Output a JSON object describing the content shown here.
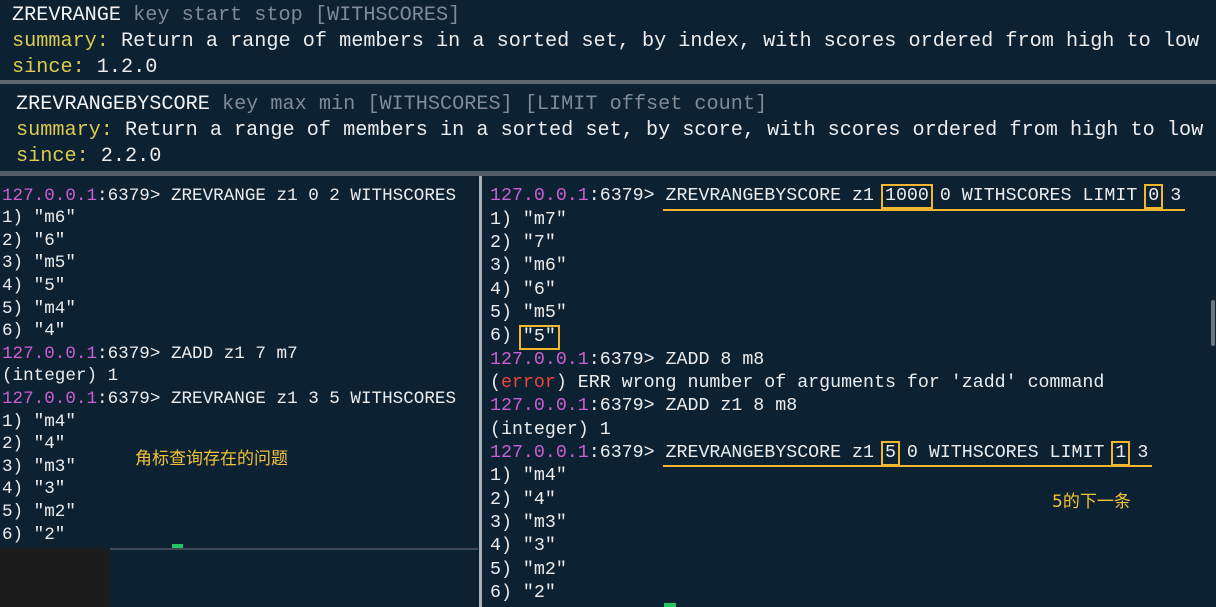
{
  "colors": {
    "background": "#0c2132",
    "text": "#ececec",
    "muted": "#7f8b97",
    "label": "#dccb50",
    "host": "#cc5fd1",
    "error": "#e8473c",
    "highlight": "#f0b72f",
    "annotation": "#f2c23a",
    "cursor": "#22c55e"
  },
  "help": [
    {
      "command": "ZREVRANGE",
      "args": "key start stop [WITHSCORES]",
      "summary_label": "summary:",
      "summary": "Return a range of members in a sorted set, by index, with scores ordered from high to low",
      "since_label": "since:",
      "since": "1.2.0"
    },
    {
      "command": "ZREVRANGEBYSCORE",
      "args": "key max min [WITHSCORES] [LIMIT offset count]",
      "summary_label": "summary:",
      "summary": "Return a range of members in a sorted set, by score, with scores ordered from high to low",
      "since_label": "since:",
      "since": "2.2.0"
    }
  ],
  "prompt": {
    "host": "127.0.0.1",
    "port": ":6379>"
  },
  "left_terminal": {
    "entries": [
      {
        "command": "ZREVRANGE z1 0 2 WITHSCORES",
        "results": [
          {
            "index": "1)",
            "value": "\"m6\""
          },
          {
            "index": "2)",
            "value": "\"6\""
          },
          {
            "index": "3)",
            "value": "\"m5\""
          },
          {
            "index": "4)",
            "value": "\"5\""
          },
          {
            "index": "5)",
            "value": "\"m4\""
          },
          {
            "index": "6)",
            "value": "\"4\""
          }
        ]
      },
      {
        "command": "ZADD z1 7 m7",
        "reply": "(integer) 1"
      },
      {
        "command": "ZREVRANGE z1 3 5 WITHSCORES",
        "results": [
          {
            "index": "1)",
            "value": "\"m4\""
          },
          {
            "index": "2)",
            "value": "\"4\""
          },
          {
            "index": "3)",
            "value": "\"m3\""
          },
          {
            "index": "4)",
            "value": "\"3\""
          },
          {
            "index": "5)",
            "value": "\"m2\""
          },
          {
            "index": "6)",
            "value": "\"2\""
          }
        ]
      }
    ],
    "annotation": "角标查询存在的问题"
  },
  "right_terminal": {
    "entries": [
      {
        "underlined": true,
        "command_segments": [
          {
            "text": "ZREVRANGEBYSCORE z1 "
          },
          {
            "text": "1000",
            "boxed": true
          },
          {
            "text": " 0 WITHSCORES LIMIT "
          },
          {
            "text": "0",
            "boxed": true
          },
          {
            "text": " 3"
          }
        ],
        "results": [
          {
            "index": "1)",
            "value": "\"m7\""
          },
          {
            "index": "2)",
            "value": "\"7\""
          },
          {
            "index": "3)",
            "value": "\"m6\""
          },
          {
            "index": "4)",
            "value": "\"6\""
          },
          {
            "index": "5)",
            "value": "\"m5\""
          },
          {
            "index": "6)",
            "value": "\"5\"",
            "boxed": true
          }
        ]
      },
      {
        "command": "ZADD 8 m8",
        "error": {
          "open": "(",
          "keyword": "error",
          "message": ") ERR wrong number of arguments for 'zadd' command"
        }
      },
      {
        "command": "ZADD z1 8 m8",
        "reply": "(integer) 1"
      },
      {
        "underlined": true,
        "command_segments": [
          {
            "text": "ZREVRANGEBYSCORE z1 "
          },
          {
            "text": "5",
            "boxed": true
          },
          {
            "text": " 0 WITHSCORES LIMIT "
          },
          {
            "text": "1",
            "boxed": true
          },
          {
            "text": " 3"
          }
        ],
        "results": [
          {
            "index": "1)",
            "value": "\"m4\""
          },
          {
            "index": "2)",
            "value": "\"4\""
          },
          {
            "index": "3)",
            "value": "\"m3\""
          },
          {
            "index": "4)",
            "value": "\"3\""
          },
          {
            "index": "5)",
            "value": "\"m2\""
          },
          {
            "index": "6)",
            "value": "\"2\""
          }
        ]
      }
    ],
    "annotation": "5的下一条"
  }
}
